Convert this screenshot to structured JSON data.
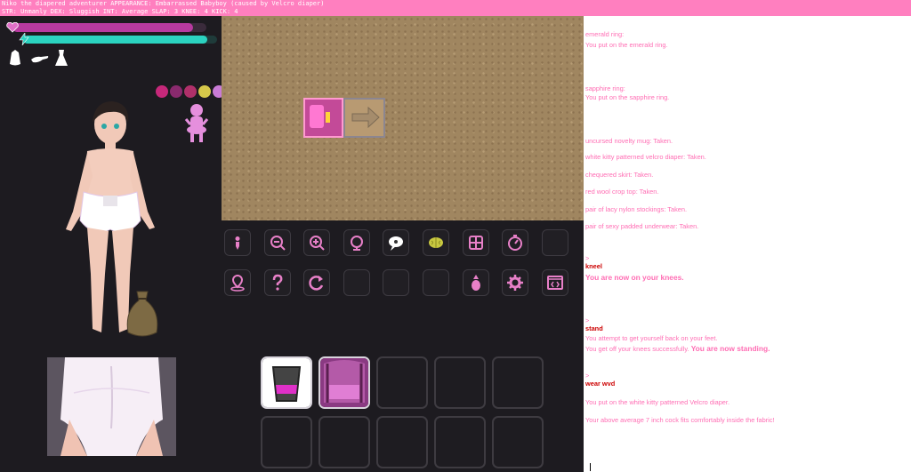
{
  "status_bar": {
    "line1": "Niko the diapered adventurer APPEARANCE: Embarrassed Babyboy (caused by Velcro diaper)",
    "line2": "STR: Unmanly    DEX: Sluggish  INT: Average    SLAP: 3 KNEE: 4 KICK: 4"
  },
  "colors": {
    "health": "#b83aa0",
    "energy": "#2bd3c0",
    "accent": "#ff7fbf",
    "log_text": "#ff6eb4",
    "log_command": "#cc0000",
    "panel": "#1d1b20"
  },
  "player": {
    "health_level": 0.93,
    "energy_level": 0.95,
    "stat_icons": [
      "diaper-bag-icon",
      "hand-icon",
      "dress-icon"
    ],
    "status_icons": [
      "infinity-icon",
      "cycle-icon",
      "cross-icon",
      "skull-icon",
      "eye-icon"
    ]
  },
  "action_buttons": [
    {
      "name": "kneel-button",
      "icon": "kneel-icon"
    },
    {
      "name": "zoom-out-button",
      "icon": "zoom-out-icon"
    },
    {
      "name": "zoom-in-button",
      "icon": "zoom-in-icon"
    },
    {
      "name": "globe-button",
      "icon": "globe-icon"
    },
    {
      "name": "talk-button",
      "icon": "speech-icon"
    },
    {
      "name": "brain-button",
      "icon": "brain-icon"
    },
    {
      "name": "inventory-button",
      "icon": "grid-icon"
    },
    {
      "name": "wait-button",
      "icon": "timer-icon"
    },
    {
      "name": "empty-button-1",
      "icon": ""
    },
    {
      "name": "map-location-button",
      "icon": "map-pin-icon"
    },
    {
      "name": "help-button",
      "icon": "question-icon"
    },
    {
      "name": "redo-button",
      "icon": "redo-icon"
    },
    {
      "name": "empty-button-2",
      "icon": ""
    },
    {
      "name": "empty-button-3",
      "icon": ""
    },
    {
      "name": "empty-button-4",
      "icon": ""
    },
    {
      "name": "pineapple-button",
      "icon": "pineapple-icon"
    },
    {
      "name": "settings-button",
      "icon": "gear-icon"
    },
    {
      "name": "console-button",
      "icon": "code-window-icon"
    }
  ],
  "inventory": [
    {
      "name": "slot-1",
      "item": "glass-icon",
      "badge": "?"
    },
    {
      "name": "slot-2",
      "item": "canopy-bed-icon",
      "badge": ""
    },
    {
      "name": "slot-3",
      "item": "",
      "badge": ""
    },
    {
      "name": "slot-4",
      "item": "",
      "badge": ""
    },
    {
      "name": "slot-5",
      "item": "",
      "badge": ""
    },
    {
      "name": "slot-6",
      "item": "",
      "badge": ""
    },
    {
      "name": "slot-7",
      "item": "",
      "badge": ""
    },
    {
      "name": "slot-8",
      "item": "",
      "badge": ""
    },
    {
      "name": "slot-9",
      "item": "",
      "badge": ""
    },
    {
      "name": "slot-10",
      "item": "",
      "badge": ""
    }
  ],
  "log": [
    {
      "text": "emerald ring:",
      "style": "normal"
    },
    {
      "text": "You put on the emerald ring.",
      "style": "normal"
    },
    {
      "text": "sapphire ring:",
      "style": "normal"
    },
    {
      "text": "You put on the sapphire ring.",
      "style": "normal"
    },
    {
      "text": "uncursed novelty mug: Taken.",
      "style": "normal"
    },
    {
      "text": "white kitty patterned velcro diaper: Taken.",
      "style": "normal"
    },
    {
      "text": "chequered skirt: Taken.",
      "style": "normal"
    },
    {
      "text": "red wool crop top: Taken.",
      "style": "normal"
    },
    {
      "text": "pair of lacy nylon stockings: Taken.",
      "style": "normal"
    },
    {
      "text": "pair of sexy padded underwear: Taken.",
      "style": "normal"
    },
    {
      "text": ">",
      "style": "normal"
    },
    {
      "text": "kneel",
      "style": "cmd"
    },
    {
      "text": "You are now on your knees.",
      "style": "big"
    },
    {
      "text": ">",
      "style": "normal"
    },
    {
      "text": "stand",
      "style": "cmd"
    },
    {
      "text": "You attempt to get yourself back on your feet.",
      "style": "normal"
    },
    {
      "text": "You get off your knees successfully.",
      "style": "normal",
      "bold_suffix": "You are now standing."
    },
    {
      "text": ">",
      "style": "normal"
    },
    {
      "text": "wear wvd",
      "style": "cmd"
    },
    {
      "text": "You put on the white kitty patterned Velcro diaper.",
      "style": "normal"
    },
    {
      "text": "Your above average 7 inch cock fits comfortably inside the fabric!",
      "style": "normal"
    }
  ]
}
